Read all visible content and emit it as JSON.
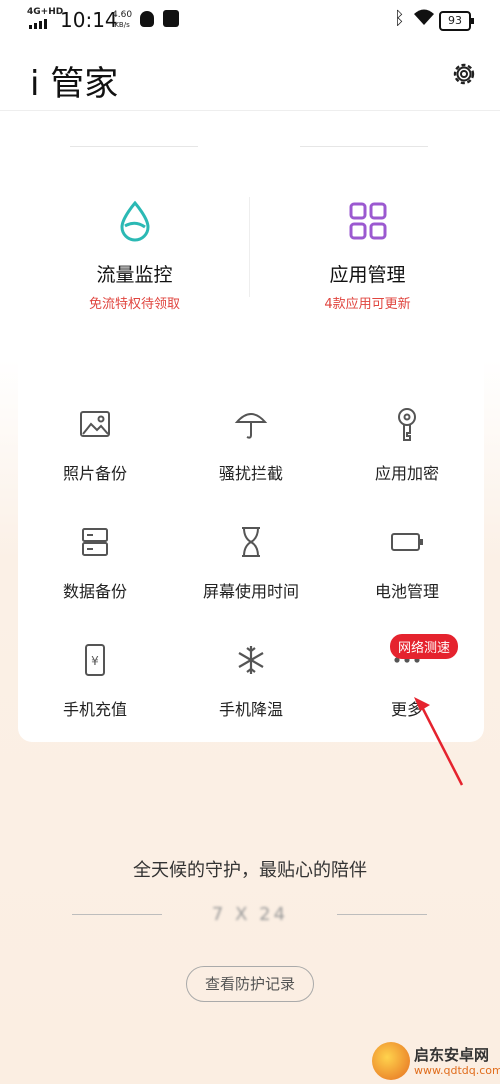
{
  "status_bar": {
    "network": "4G+HD",
    "time": "10:14",
    "speed_value": "4.60",
    "speed_unit": "KB/s",
    "battery": "93"
  },
  "header": {
    "title": "i 管家"
  },
  "features": [
    {
      "name": "流量监控",
      "sub": "免流特权待领取",
      "icon": "water-drop-icon"
    },
    {
      "name": "应用管理",
      "sub": "4款应用可更新",
      "icon": "app-grid-icon"
    }
  ],
  "grid": [
    {
      "label": "照片备份",
      "icon": "photo-icon"
    },
    {
      "label": "骚扰拦截",
      "icon": "umbrella-icon"
    },
    {
      "label": "应用加密",
      "icon": "key-icon"
    },
    {
      "label": "数据备份",
      "icon": "storage-icon"
    },
    {
      "label": "屏幕使用时间",
      "icon": "hourglass-icon"
    },
    {
      "label": "电池管理",
      "icon": "battery-icon"
    },
    {
      "label": "手机充值",
      "icon": "phone-recharge-icon"
    },
    {
      "label": "手机降温",
      "icon": "snowflake-icon"
    },
    {
      "label": "更多",
      "icon": "more-dots-icon"
    }
  ],
  "more_badge": "网络测速",
  "footer": {
    "slogan": "全天候的守护，最贴心的陪伴",
    "service": "7 X 24",
    "record_button": "查看防护记录"
  },
  "watermark": {
    "name": "启东安卓网",
    "url": "www.qdtdq.com"
  },
  "colors": {
    "accent_red": "#e0453f",
    "teal": "#2bb9b4",
    "purple": "#9b59d0"
  }
}
